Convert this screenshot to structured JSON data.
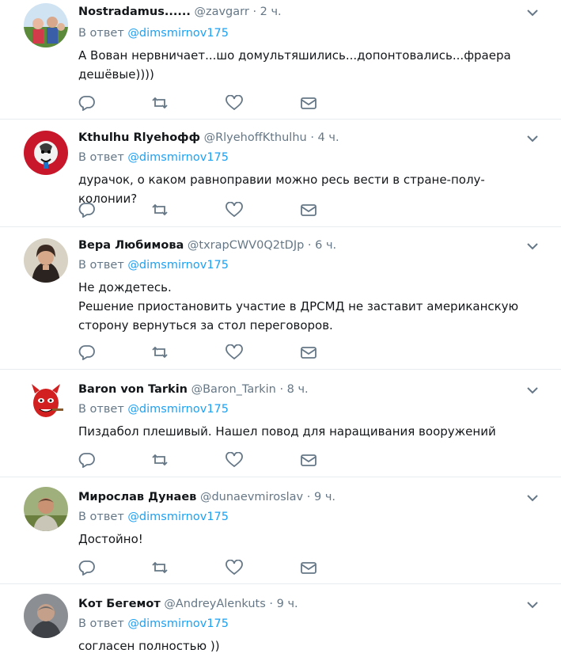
{
  "colors": {
    "link": "#1da1f2",
    "muted": "#657786",
    "text": "#14171a",
    "divider": "#e6ecf0"
  },
  "icons": [
    "reply-icon",
    "retweet-icon",
    "like-icon",
    "direct-message-icon",
    "chevron-down-icon"
  ],
  "tweets": [
    {
      "name": "Nostradamus......",
      "handle": "@zavgarr",
      "dot": "·",
      "time": "2 ч.",
      "reply_prefix": "В ответ",
      "reply_to": "@dimsmirnov175",
      "lines": [
        "А Вован нервничает...шо домультяшились...допонтовались...фраера дешёвые))))"
      ]
    },
    {
      "name": "Kthulhu Rlyehoфф",
      "handle": "@RlyehoffKthulhu",
      "dot": "·",
      "time": "4 ч.",
      "reply_prefix": "В ответ",
      "reply_to": "@dimsmirnov175",
      "lines": [
        "дурачок, о каком равноправии можно ресь вести в стране-полу-колонии?"
      ]
    },
    {
      "name": "Вера Любимова",
      "handle": "@txrapCWV0Q2tDJp",
      "dot": "·",
      "time": "6 ч.",
      "reply_prefix": "В ответ",
      "reply_to": "@dimsmirnov175",
      "lines": [
        "Не дождетесь.",
        "Решение приостановить участие в ДРСМД не заставит американскую сторону вернуться за стол переговоров."
      ]
    },
    {
      "name": "Baron von Tarkin",
      "handle": "@Baron_Tarkin",
      "dot": "·",
      "time": "8 ч.",
      "reply_prefix": "В ответ",
      "reply_to": "@dimsmirnov175",
      "lines": [
        "Пиздабол плешивый. Нашел повод для наращивания вооружений"
      ]
    },
    {
      "name": "Мирослав Дунаев",
      "handle": "@dunaevmiroslav",
      "dot": "·",
      "time": "9 ч.",
      "reply_prefix": "В ответ",
      "reply_to": "@dimsmirnov175",
      "lines": [
        "Достойно!"
      ]
    },
    {
      "name": "Кот Бегемот",
      "handle": "@AndreyAlenkuts",
      "dot": "·",
      "time": "9 ч.",
      "reply_prefix": "В ответ",
      "reply_to": "@dimsmirnov175",
      "lines": [
        "согласен полностью ))"
      ]
    }
  ]
}
